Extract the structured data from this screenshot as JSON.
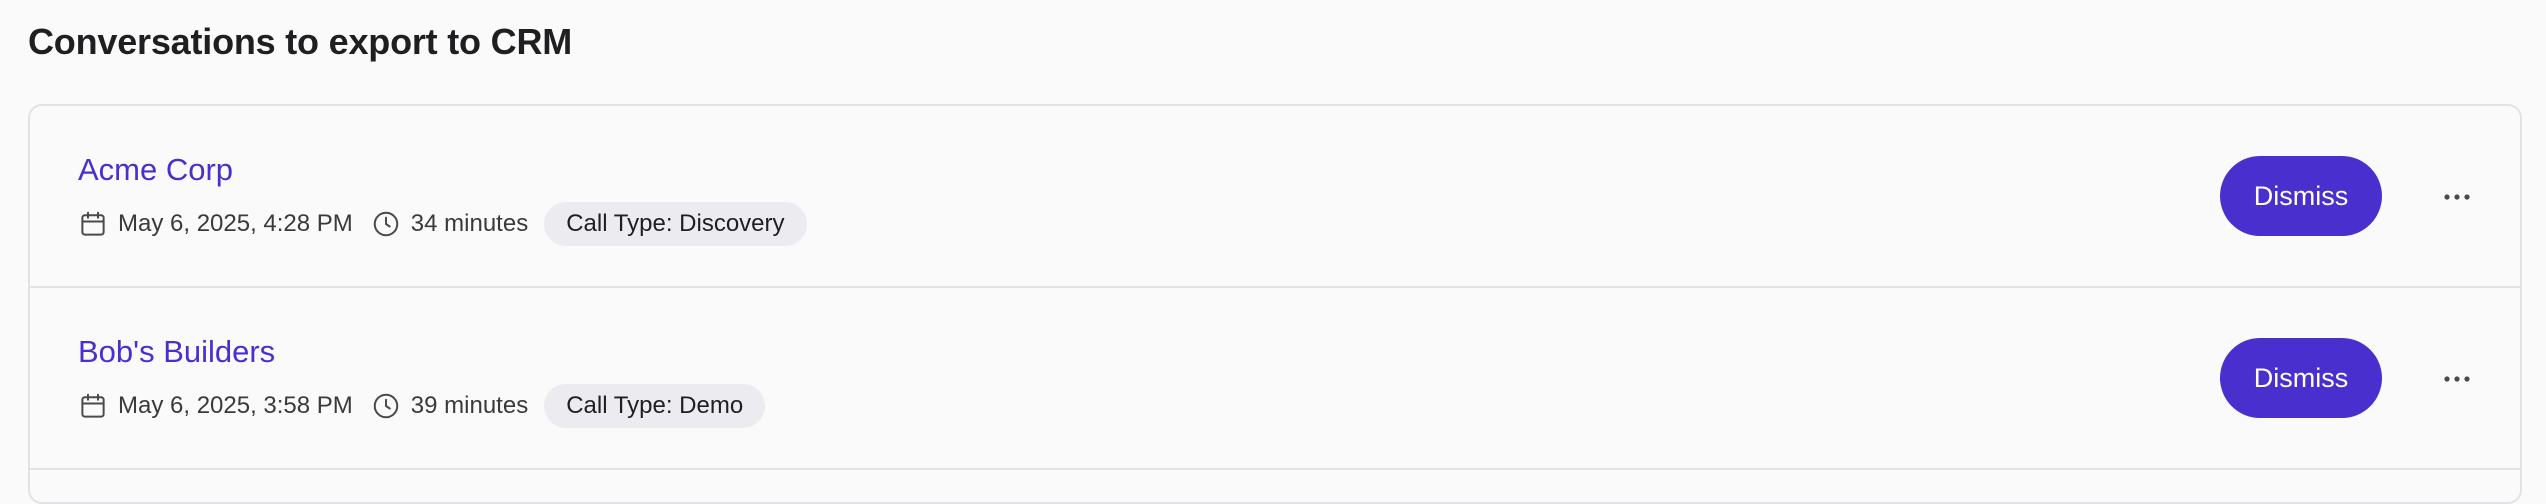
{
  "page": {
    "title": "Conversations to export to CRM"
  },
  "conversations": [
    {
      "company": "Acme Corp",
      "date": "May 6, 2025, 4:28 PM",
      "duration": "34 minutes",
      "call_type": "Call Type: Discovery",
      "dismiss_label": "Dismiss"
    },
    {
      "company": "Bob's Builders",
      "date": "May 6, 2025, 3:58 PM",
      "duration": "39 minutes",
      "call_type": "Call Type: Demo",
      "dismiss_label": "Dismiss"
    }
  ],
  "icons": {
    "date": "calendar-icon",
    "duration": "clock-icon",
    "more": "more-horizontal-icon"
  },
  "colors": {
    "accent": "#4a2fcf",
    "badge_bg": "#ececf0",
    "border": "#e3e3e6",
    "background": "#fafafa"
  }
}
